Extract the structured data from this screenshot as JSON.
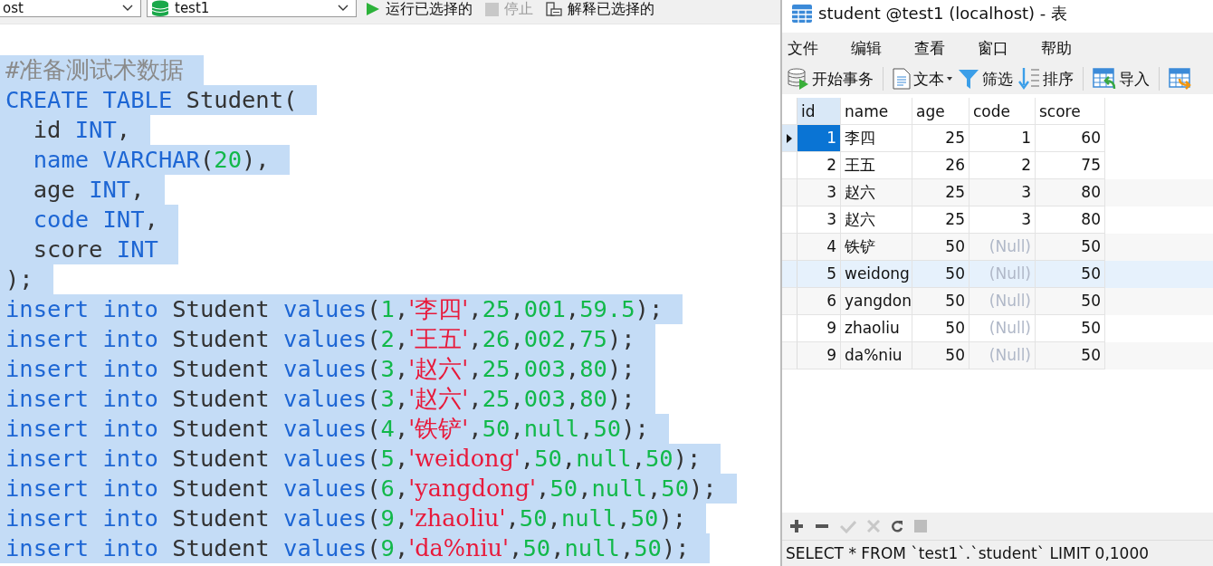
{
  "editor_toolbar": {
    "connection": "ost",
    "database": "test1",
    "run_button": "运行已选择的",
    "stop_button": {
      "label": "停止",
      "disabled": true
    },
    "explain_button": "解释已选择的"
  },
  "code_lines": [
    {
      "tokens": [
        {
          "kind": "comment",
          "text": "#准备测试术数据"
        }
      ]
    },
    {
      "tokens": [
        {
          "kind": "keyword",
          "text": "CREATE TABLE"
        },
        {
          "kind": "plain",
          "text": " Student("
        }
      ]
    },
    {
      "tokens": [
        {
          "kind": "plain",
          "text": "  id "
        },
        {
          "kind": "keyword",
          "text": "INT"
        },
        {
          "kind": "plain",
          "text": ","
        }
      ]
    },
    {
      "tokens": [
        {
          "kind": "keyword",
          "text": "  name VARCHAR"
        },
        {
          "kind": "plain",
          "text": "("
        },
        {
          "kind": "number",
          "text": "20"
        },
        {
          "kind": "plain",
          "text": "),"
        }
      ]
    },
    {
      "tokens": [
        {
          "kind": "plain",
          "text": "  age "
        },
        {
          "kind": "keyword",
          "text": "INT"
        },
        {
          "kind": "plain",
          "text": ","
        }
      ]
    },
    {
      "tokens": [
        {
          "kind": "keyword",
          "text": "  code INT"
        },
        {
          "kind": "plain",
          "text": ","
        }
      ]
    },
    {
      "tokens": [
        {
          "kind": "plain",
          "text": "  score "
        },
        {
          "kind": "keyword",
          "text": "INT"
        }
      ]
    },
    {
      "tokens": [
        {
          "kind": "plain",
          "text": ");"
        }
      ]
    },
    {
      "tokens": [
        {
          "kind": "keyword",
          "text": "insert into"
        },
        {
          "kind": "plain",
          "text": " Student "
        },
        {
          "kind": "keyword",
          "text": "values"
        },
        {
          "kind": "plain",
          "text": "("
        },
        {
          "kind": "number",
          "text": "1"
        },
        {
          "kind": "plain",
          "text": ","
        },
        {
          "kind": "string",
          "text": "'李四'"
        },
        {
          "kind": "plain",
          "text": ","
        },
        {
          "kind": "number",
          "text": "25"
        },
        {
          "kind": "plain",
          "text": ","
        },
        {
          "kind": "number",
          "text": "001"
        },
        {
          "kind": "plain",
          "text": ","
        },
        {
          "kind": "number",
          "text": "59.5"
        },
        {
          "kind": "plain",
          "text": ");"
        }
      ]
    },
    {
      "tokens": [
        {
          "kind": "keyword",
          "text": "insert into"
        },
        {
          "kind": "plain",
          "text": " Student "
        },
        {
          "kind": "keyword",
          "text": "values"
        },
        {
          "kind": "plain",
          "text": "("
        },
        {
          "kind": "number",
          "text": "2"
        },
        {
          "kind": "plain",
          "text": ","
        },
        {
          "kind": "string",
          "text": "'王五'"
        },
        {
          "kind": "plain",
          "text": ","
        },
        {
          "kind": "number",
          "text": "26"
        },
        {
          "kind": "plain",
          "text": ","
        },
        {
          "kind": "number",
          "text": "002"
        },
        {
          "kind": "plain",
          "text": ","
        },
        {
          "kind": "number",
          "text": "75"
        },
        {
          "kind": "plain",
          "text": ");"
        }
      ]
    },
    {
      "tokens": [
        {
          "kind": "keyword",
          "text": "insert into"
        },
        {
          "kind": "plain",
          "text": " Student "
        },
        {
          "kind": "keyword",
          "text": "values"
        },
        {
          "kind": "plain",
          "text": "("
        },
        {
          "kind": "number",
          "text": "3"
        },
        {
          "kind": "plain",
          "text": ","
        },
        {
          "kind": "string",
          "text": "'赵六'"
        },
        {
          "kind": "plain",
          "text": ","
        },
        {
          "kind": "number",
          "text": "25"
        },
        {
          "kind": "plain",
          "text": ","
        },
        {
          "kind": "number",
          "text": "003"
        },
        {
          "kind": "plain",
          "text": ","
        },
        {
          "kind": "number",
          "text": "80"
        },
        {
          "kind": "plain",
          "text": ");"
        }
      ]
    },
    {
      "tokens": [
        {
          "kind": "keyword",
          "text": "insert into"
        },
        {
          "kind": "plain",
          "text": " Student "
        },
        {
          "kind": "keyword",
          "text": "values"
        },
        {
          "kind": "plain",
          "text": "("
        },
        {
          "kind": "number",
          "text": "3"
        },
        {
          "kind": "plain",
          "text": ","
        },
        {
          "kind": "string",
          "text": "'赵六'"
        },
        {
          "kind": "plain",
          "text": ","
        },
        {
          "kind": "number",
          "text": "25"
        },
        {
          "kind": "plain",
          "text": ","
        },
        {
          "kind": "number",
          "text": "003"
        },
        {
          "kind": "plain",
          "text": ","
        },
        {
          "kind": "number",
          "text": "80"
        },
        {
          "kind": "plain",
          "text": ");"
        }
      ]
    },
    {
      "tokens": [
        {
          "kind": "keyword",
          "text": "insert into"
        },
        {
          "kind": "plain",
          "text": " Student "
        },
        {
          "kind": "keyword",
          "text": "values"
        },
        {
          "kind": "plain",
          "text": "("
        },
        {
          "kind": "number",
          "text": "4"
        },
        {
          "kind": "plain",
          "text": ","
        },
        {
          "kind": "string",
          "text": "'铁铲'"
        },
        {
          "kind": "plain",
          "text": ","
        },
        {
          "kind": "number",
          "text": "50"
        },
        {
          "kind": "plain",
          "text": ","
        },
        {
          "kind": "number",
          "text": "null"
        },
        {
          "kind": "plain",
          "text": ","
        },
        {
          "kind": "number",
          "text": "50"
        },
        {
          "kind": "plain",
          "text": ");"
        }
      ]
    },
    {
      "tokens": [
        {
          "kind": "keyword",
          "text": "insert into"
        },
        {
          "kind": "plain",
          "text": " Student "
        },
        {
          "kind": "keyword",
          "text": "values"
        },
        {
          "kind": "plain",
          "text": "("
        },
        {
          "kind": "number",
          "text": "5"
        },
        {
          "kind": "plain",
          "text": ","
        },
        {
          "kind": "string",
          "text": "'weidong'"
        },
        {
          "kind": "plain",
          "text": ","
        },
        {
          "kind": "number",
          "text": "50"
        },
        {
          "kind": "plain",
          "text": ","
        },
        {
          "kind": "number",
          "text": "null"
        },
        {
          "kind": "plain",
          "text": ","
        },
        {
          "kind": "number",
          "text": "50"
        },
        {
          "kind": "plain",
          "text": ");"
        }
      ]
    },
    {
      "tokens": [
        {
          "kind": "keyword",
          "text": "insert into"
        },
        {
          "kind": "plain",
          "text": " Student "
        },
        {
          "kind": "keyword",
          "text": "values"
        },
        {
          "kind": "plain",
          "text": "("
        },
        {
          "kind": "number",
          "text": "6"
        },
        {
          "kind": "plain",
          "text": ","
        },
        {
          "kind": "string",
          "text": "'yangdong'"
        },
        {
          "kind": "plain",
          "text": ","
        },
        {
          "kind": "number",
          "text": "50"
        },
        {
          "kind": "plain",
          "text": ","
        },
        {
          "kind": "number",
          "text": "null"
        },
        {
          "kind": "plain",
          "text": ","
        },
        {
          "kind": "number",
          "text": "50"
        },
        {
          "kind": "plain",
          "text": ");"
        }
      ]
    },
    {
      "tokens": [
        {
          "kind": "keyword",
          "text": "insert into"
        },
        {
          "kind": "plain",
          "text": " Student "
        },
        {
          "kind": "keyword",
          "text": "values"
        },
        {
          "kind": "plain",
          "text": "("
        },
        {
          "kind": "number",
          "text": "9"
        },
        {
          "kind": "plain",
          "text": ","
        },
        {
          "kind": "string",
          "text": "'zhaoliu'"
        },
        {
          "kind": "plain",
          "text": ","
        },
        {
          "kind": "number",
          "text": "50"
        },
        {
          "kind": "plain",
          "text": ","
        },
        {
          "kind": "number",
          "text": "null"
        },
        {
          "kind": "plain",
          "text": ","
        },
        {
          "kind": "number",
          "text": "50"
        },
        {
          "kind": "plain",
          "text": ");"
        }
      ]
    },
    {
      "tokens": [
        {
          "kind": "keyword",
          "text": "insert into"
        },
        {
          "kind": "plain",
          "text": " Student "
        },
        {
          "kind": "keyword",
          "text": "values"
        },
        {
          "kind": "plain",
          "text": "("
        },
        {
          "kind": "number",
          "text": "9"
        },
        {
          "kind": "plain",
          "text": ","
        },
        {
          "kind": "string",
          "text": "'da%niu'"
        },
        {
          "kind": "plain",
          "text": ","
        },
        {
          "kind": "number",
          "text": "50"
        },
        {
          "kind": "plain",
          "text": ","
        },
        {
          "kind": "number",
          "text": "null"
        },
        {
          "kind": "plain",
          "text": ","
        },
        {
          "kind": "number",
          "text": "50"
        },
        {
          "kind": "plain",
          "text": ");"
        }
      ]
    }
  ],
  "table_window": {
    "title": "student @test1 (localhost) - 表",
    "menu": [
      "文件",
      "编辑",
      "查看",
      "窗口",
      "帮助"
    ],
    "toolbar": [
      {
        "kind": "transaction",
        "label": "开始事务"
      },
      {
        "kind": "text",
        "label": "文本"
      },
      {
        "kind": "filter",
        "label": "筛选"
      },
      {
        "kind": "sort",
        "label": "排序"
      },
      {
        "kind": "import",
        "label": "导入"
      },
      {
        "kind": "export"
      }
    ],
    "columns": [
      "id",
      "name",
      "age",
      "code",
      "score"
    ],
    "rows": [
      {
        "selected": true,
        "hovered": false,
        "cells": [
          {
            "text": "1"
          },
          {
            "text": "李四"
          },
          {
            "text": "25"
          },
          {
            "text": "1"
          },
          {
            "text": "60"
          }
        ]
      },
      {
        "selected": false,
        "hovered": false,
        "cells": [
          {
            "text": "2"
          },
          {
            "text": "王五"
          },
          {
            "text": "26"
          },
          {
            "text": "2"
          },
          {
            "text": "75"
          }
        ]
      },
      {
        "selected": false,
        "hovered": false,
        "cells": [
          {
            "text": "3"
          },
          {
            "text": "赵六"
          },
          {
            "text": "25"
          },
          {
            "text": "3"
          },
          {
            "text": "80"
          }
        ]
      },
      {
        "selected": false,
        "hovered": false,
        "cells": [
          {
            "text": "3"
          },
          {
            "text": "赵六"
          },
          {
            "text": "25"
          },
          {
            "text": "3"
          },
          {
            "text": "80"
          }
        ]
      },
      {
        "selected": false,
        "hovered": false,
        "cells": [
          {
            "text": "4"
          },
          {
            "text": "铁铲"
          },
          {
            "text": "50"
          },
          {
            "text": "(Null)",
            "null": true
          },
          {
            "text": "50"
          }
        ]
      },
      {
        "selected": false,
        "hovered": true,
        "cells": [
          {
            "text": "5"
          },
          {
            "text": "weidong"
          },
          {
            "text": "50"
          },
          {
            "text": "(Null)",
            "null": true
          },
          {
            "text": "50"
          }
        ]
      },
      {
        "selected": false,
        "hovered": false,
        "cells": [
          {
            "text": "6"
          },
          {
            "text": "yangdon"
          },
          {
            "text": "50"
          },
          {
            "text": "(Null)",
            "null": true
          },
          {
            "text": "50"
          }
        ]
      },
      {
        "selected": false,
        "hovered": false,
        "cells": [
          {
            "text": "9"
          },
          {
            "text": "zhaoliu"
          },
          {
            "text": "50"
          },
          {
            "text": "(Null)",
            "null": true
          },
          {
            "text": "50"
          }
        ]
      },
      {
        "selected": false,
        "hovered": false,
        "cells": [
          {
            "text": "9"
          },
          {
            "text": "da%niu"
          },
          {
            "text": "50"
          },
          {
            "text": "(Null)",
            "null": true
          },
          {
            "text": "50"
          }
        ]
      }
    ],
    "status_bar": "SELECT * FROM `test1`.`student` LIMIT 0,1000"
  }
}
